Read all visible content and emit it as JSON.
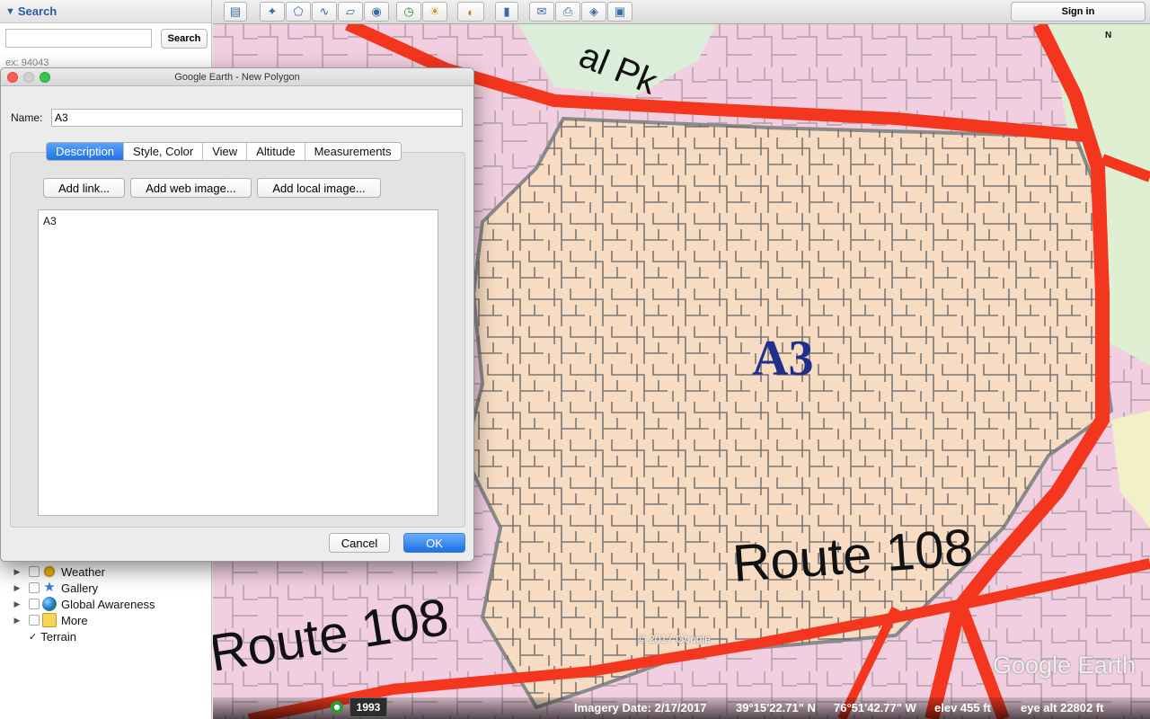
{
  "sidebar": {
    "search_title": "Search",
    "search_value": "",
    "search_button": "Search",
    "search_hint": "ex: 94043",
    "layers": [
      {
        "label": "Weather",
        "icon": "weather-icon"
      },
      {
        "label": "Gallery",
        "icon": "gallery-icon"
      },
      {
        "label": "Global Awareness",
        "icon": "globe-icon"
      },
      {
        "label": "More",
        "icon": "more-icon"
      }
    ],
    "terrain_label": "Terrain",
    "terrain_checked": true
  },
  "toolbar": {
    "sign_in": "Sign in",
    "tools": [
      "sidebar-toggle-icon",
      "add-placemark-icon",
      "add-polygon-icon",
      "add-path-icon",
      "add-image-overlay-icon",
      "record-tour-icon",
      "historical-imagery-icon",
      "sun-icon",
      "planets-icon",
      "ruler-icon",
      "email-icon",
      "print-icon",
      "view-in-maps-icon",
      "save-image-icon"
    ]
  },
  "dialog": {
    "title": "Google Earth - New Polygon",
    "name_label": "Name:",
    "name_value": "A3",
    "tabs": [
      "Description",
      "Style, Color",
      "View",
      "Altitude",
      "Measurements"
    ],
    "active_tab": "Description",
    "add_link": "Add link...",
    "add_web_image": "Add web image...",
    "add_local_image": "Add local image...",
    "description": "A3",
    "cancel": "Cancel",
    "ok": "OK"
  },
  "map": {
    "compass": "N",
    "labels": {
      "area": "A3",
      "route_right": "Route 108",
      "route_left": "Route 108",
      "park": "al Pk"
    },
    "copyright": "© 2017 Google",
    "brand": "Google Earth",
    "colors": {
      "polygon_fill": "#f7dcc3",
      "road": "#f4361e",
      "streets": "#666666"
    }
  },
  "status": {
    "year": "1993",
    "imagery_date": "Imagery Date: 2/17/2017",
    "lat": "39°15'22.71\" N",
    "lon": "76°51'42.77\" W",
    "elev": "elev   455 ft",
    "eye_alt": "eye alt  22802 ft"
  }
}
